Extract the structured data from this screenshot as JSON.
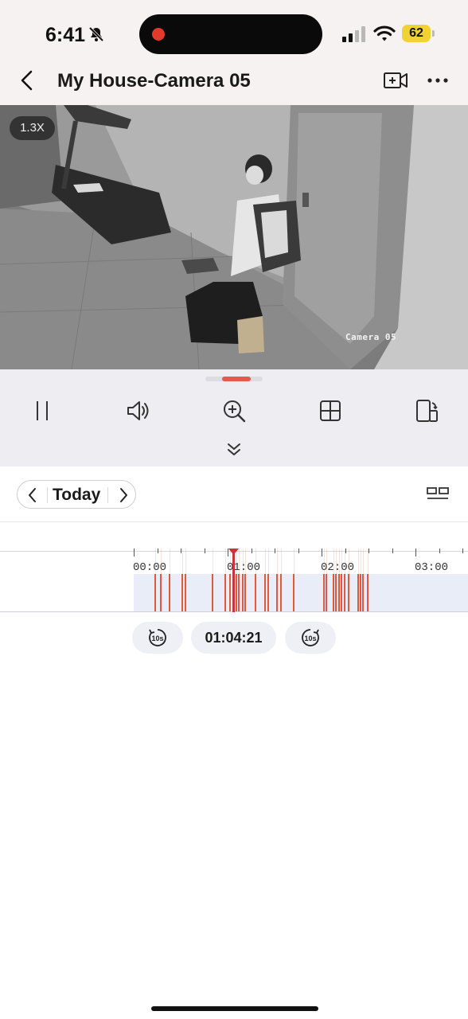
{
  "status_bar": {
    "time": "6:41",
    "battery": "62",
    "icons": [
      "bell-slash-icon",
      "signal-icon",
      "wifi-icon",
      "battery-icon"
    ],
    "recording_dot_color": "#e23b2e"
  },
  "header": {
    "title": "My House-Camera 05",
    "icons": [
      "back-icon",
      "record-video-icon",
      "more-icon"
    ]
  },
  "video": {
    "zoom": "1.3X",
    "camera_label": "Camera 05"
  },
  "controls": {
    "icons": [
      "pause-icon",
      "volume-icon",
      "zoom-in-icon",
      "grid-icon",
      "rotate-screen-icon"
    ],
    "collapse_icon": "chevron-double-down-icon"
  },
  "playback": {
    "date_label": "Today",
    "date_icons": [
      "chevron-left-icon",
      "chevron-right-icon"
    ],
    "layout_icon": "layout-icon",
    "timeline": {
      "labels": [
        "00:00",
        "01:00",
        "02:00",
        "03:00"
      ],
      "accent_color": "#e0593d",
      "playhead_color": "#c9363a"
    },
    "current_time": "01:04:21",
    "skip_back_icon": "rewind-10s-icon",
    "skip_forward_icon": "forward-10s-icon",
    "skip_text": "10s"
  }
}
